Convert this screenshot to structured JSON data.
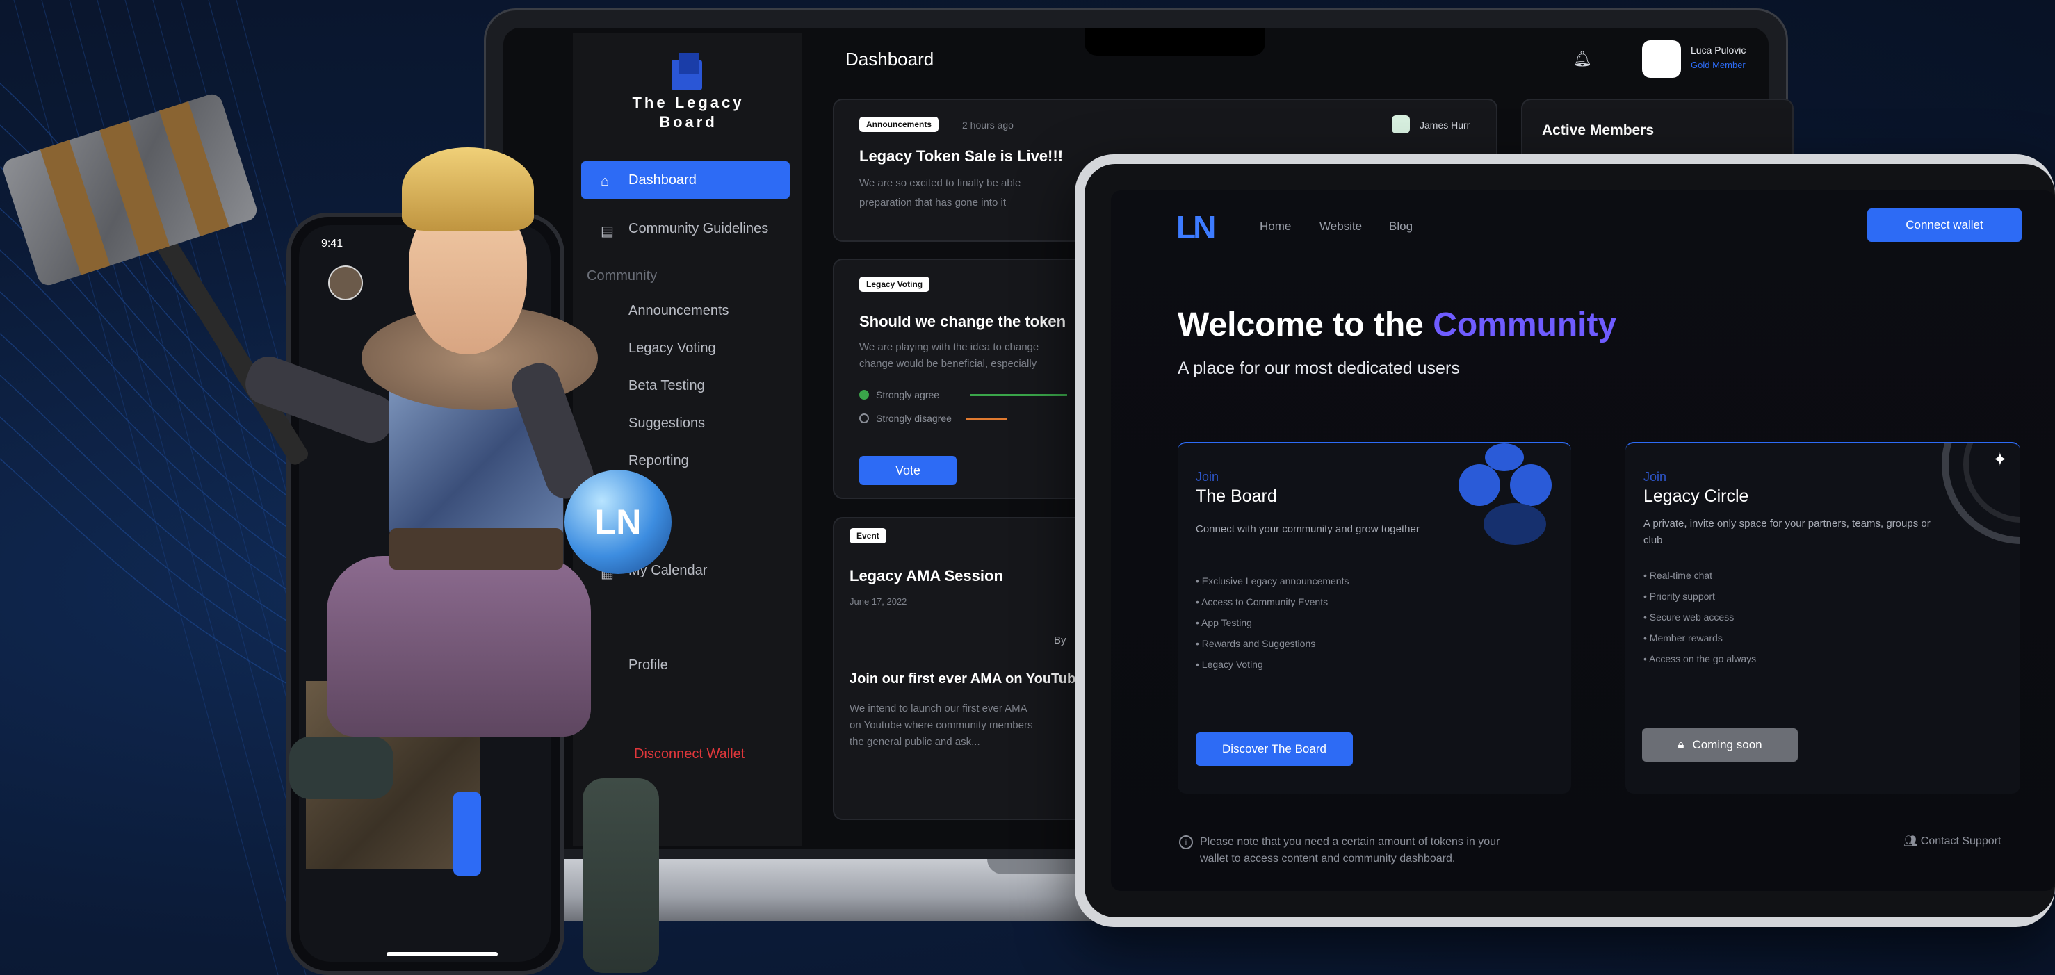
{
  "laptop": {
    "brand": {
      "name": "The Legacy Board"
    },
    "sidebar": {
      "items": [
        {
          "label": "Dashboard"
        },
        {
          "label": "Community Guidelines"
        },
        {
          "label": "Announcements"
        },
        {
          "label": "Legacy Voting"
        },
        {
          "label": "Beta Testing"
        },
        {
          "label": "Suggestions"
        },
        {
          "label": "Reporting"
        },
        {
          "label": "My Calendar"
        },
        {
          "label": "Profile"
        }
      ],
      "section_community": "Community",
      "disconnect": "Disconnect Wallet"
    },
    "topbar": {
      "title": "Dashboard",
      "user_name": "Luca Pulovic",
      "user_role": "Gold Member"
    },
    "feed": [
      {
        "tag": "Announcements",
        "time": "2 hours ago",
        "author": "James Hurr",
        "title": "Legacy Token Sale is Live!!!",
        "text_1": "We are so excited to finally be able",
        "text_2": "preparation that has gone into it"
      },
      {
        "tag": "Legacy Voting",
        "title": "Should we change the token",
        "text_1": "We are playing with the idea to change",
        "text_2": "change would be beneficial, especially",
        "option_1": "Strongly agree",
        "option_2": "Strongly disagree",
        "button": "Vote"
      },
      {
        "tag": "Event",
        "title": "Legacy AMA Session",
        "date": "June 17, 2022",
        "by": "By",
        "subtitle": "Join our first ever AMA on YouTub",
        "text_1": "We intend to launch our first ever AMA",
        "text_2": "on Youtube where community members",
        "text_3": "the general public and ask..."
      }
    ],
    "panel_title": "Active Members"
  },
  "tablet": {
    "nav": {
      "logo": "LN",
      "home": "Home",
      "website": "Website",
      "blog": "Blog",
      "connect": "Connect wallet"
    },
    "hero": {
      "welcome": "Welcome to the",
      "accent": "Community",
      "subtitle": "A place for our most dedicated users"
    },
    "cards": [
      {
        "join": "Join",
        "title": "The Board",
        "desc": "Connect with your community and grow together",
        "features": [
          "Exclusive Legacy announcements",
          "Access to Community Events",
          "App Testing",
          "Rewards and Suggestions",
          "Legacy Voting"
        ],
        "button": "Discover The Board"
      },
      {
        "join": "Join",
        "title": "Legacy Circle",
        "desc": "A private, invite only space for your partners, teams, groups or club",
        "features": [
          "Real-time chat",
          "Priority support",
          "Secure web access",
          "Member rewards",
          "Access on the go always"
        ],
        "button": "Coming soon"
      }
    ],
    "footer": {
      "note": "Please note that you need a certain amount of tokens in your wallet to access content and community dashboard.",
      "support": "Contact Support"
    }
  },
  "phone": {
    "time": "9:41"
  },
  "orb_logo": "LN",
  "colors": {
    "accent_blue": "#2d6bf5",
    "accent_purple": "#6f5cff",
    "danger": "#e0373b",
    "background": "#0b1a36"
  }
}
